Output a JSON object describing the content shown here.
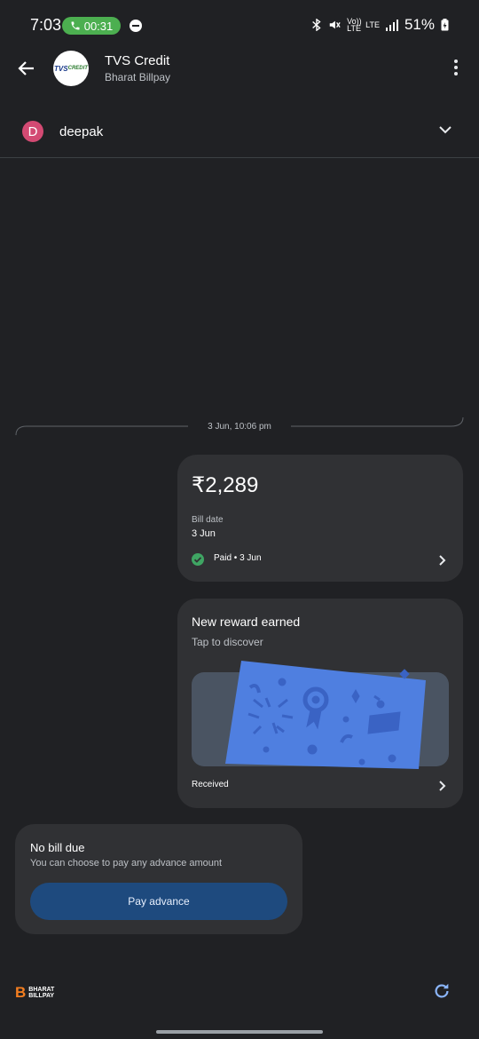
{
  "status_bar": {
    "time": "7:03",
    "call_timer": "00:31",
    "network_volte": "Vo)) LTE",
    "network_lte": "LTE",
    "battery": "51%"
  },
  "header": {
    "logo_text": "TVS",
    "logo_subtext": "CREDIT",
    "biller_name": "TVS Credit",
    "biller_category": "Bharat Billpay"
  },
  "account": {
    "avatar_initial": "D",
    "name": "deepak"
  },
  "timeline": {
    "timestamp": "3 Jun, 10:06 pm"
  },
  "bill_card": {
    "amount": "₹2,289",
    "bill_date_label": "Bill date",
    "bill_date_value": "3 Jun",
    "status": "Paid • 3 Jun"
  },
  "reward_card": {
    "title": "New reward earned",
    "subtitle": "Tap to discover",
    "status": "Received"
  },
  "due_card": {
    "title": "No bill due",
    "subtitle": "You can choose to pay any advance amount",
    "button_label": "Pay advance"
  },
  "footer": {
    "logo_b": "B",
    "logo_line1": "BHARAT",
    "logo_line2": "BILLPAY"
  },
  "colors": {
    "background": "#202124",
    "card": "#303134",
    "accent_blue": "#4f7fe0",
    "button_blue": "#1e4a7e",
    "paid_green": "#3fa563",
    "call_green": "#4caf50",
    "avatar_pink": "#d34a73",
    "bharat_orange": "#f37e20"
  }
}
